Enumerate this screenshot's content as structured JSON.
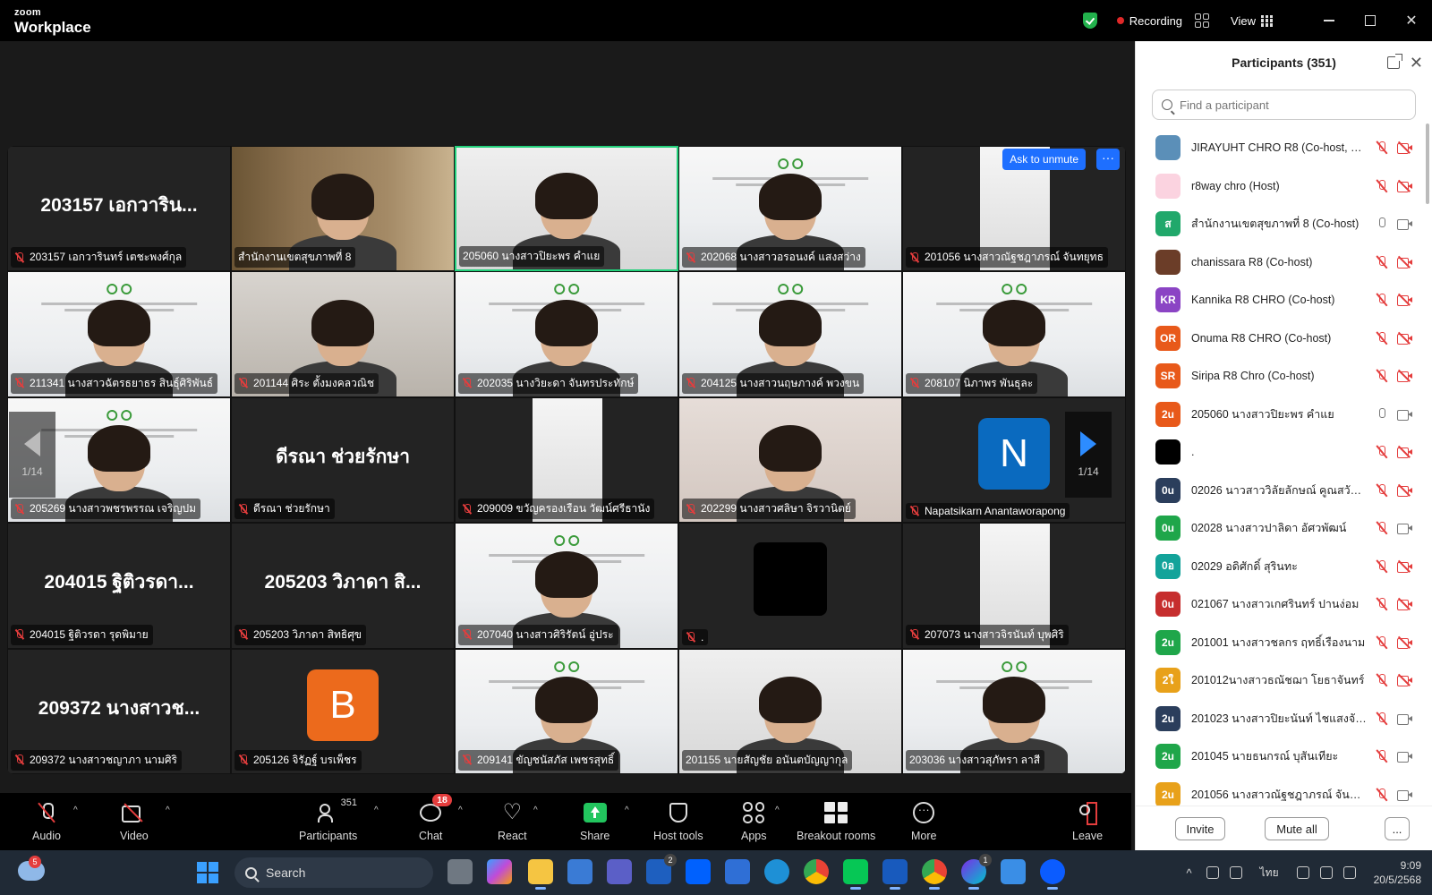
{
  "app": {
    "logo_top": "zoom",
    "logo_bottom": "Workplace"
  },
  "titlebar": {
    "recording": "Recording",
    "view": "View"
  },
  "colors": {
    "accent": "#2d8cff",
    "active_speaker": "#22d07a",
    "muted": "#e43d3d",
    "share": "#22c55e"
  },
  "gallery": {
    "ask_to_unmute": "Ask to unmute",
    "page_left": "1/14",
    "page_right": "1/14",
    "tiles": [
      {
        "big": "203157 เอกวาริน...",
        "name": "203157 เอกวารินทร์ เตชะพงศ์กุล",
        "muted": true,
        "bg": "dark"
      },
      {
        "big": "",
        "name": "สำนักงานเขตสุขภาพที่ 8",
        "muted": false,
        "bg": "office"
      },
      {
        "big": "",
        "name": "205060 นางสาวปิยะพร คำแย",
        "muted": false,
        "bg": "white",
        "active": true
      },
      {
        "big": "",
        "name": "202068 นางสาวอรอนงค์ แสงสว่าง",
        "muted": true,
        "bg": "slide"
      },
      {
        "big": "",
        "name": "201056 นางสาวณัฐชฎาภรณ์ จันทยุทธ",
        "muted": true,
        "bg": "portrait"
      },
      {
        "big": "",
        "name": "211341 นางสาวฉัตรธยาธร สินธุ์ศิริพันธ์",
        "muted": true,
        "bg": "slide"
      },
      {
        "big": "",
        "name": "201144 ศิระ ตั้งมงคลวณิช",
        "muted": true,
        "bg": "room"
      },
      {
        "big": "",
        "name": "202035 นางวิยะดา จันทรประทักษ์",
        "muted": true,
        "bg": "slide"
      },
      {
        "big": "",
        "name": "204125 นางสาวนฤษภางค์ พวงขน",
        "muted": true,
        "bg": "slide"
      },
      {
        "big": "",
        "name": "208107 นิภาพร พันธุละ",
        "muted": true,
        "bg": "slide"
      },
      {
        "big": "",
        "name": "205269 นางสาวพชรพรรณ เจริญปม",
        "muted": true,
        "bg": "slide"
      },
      {
        "big": "ดีรณา ช่วยรักษา",
        "name": "ดีรณา ช่วยรักษา",
        "muted": true,
        "bg": "dark"
      },
      {
        "big": "",
        "name": "209009 ขวัญครองเรือน วัฒน์ศรีธานัง",
        "muted": true,
        "bg": "portrait"
      },
      {
        "big": "",
        "name": "202299 นางสาวศลิษา จิรวานิตย์",
        "muted": true,
        "bg": "bedroom"
      },
      {
        "big": "",
        "name": "Napatsikarn Anantaworapong",
        "muted": true,
        "bg": "avatar",
        "avatar": "N",
        "avatar_color": "#0a6abf"
      },
      {
        "big": "204015 ฐิติวรดา...",
        "name": "204015 ฐิติวรดา รุดพิมาย",
        "muted": true,
        "bg": "dark"
      },
      {
        "big": "205203 วิภาดา สิ...",
        "name": "205203 วิภาดา สิทธิศุข",
        "muted": true,
        "bg": "dark"
      },
      {
        "big": "",
        "name": "207040 นางสาวศิริรัตน์ อู่ประ",
        "muted": true,
        "bg": "slide"
      },
      {
        "big": "",
        "name": ".",
        "muted": true,
        "bg": "blackbox"
      },
      {
        "big": "",
        "name": "207073 นางสาวจิรนันท์ บุพศิริ",
        "muted": true,
        "bg": "portrait"
      },
      {
        "big": "209372 นางสาวช...",
        "name": "209372 นางสาวชญาภา นามศิริ",
        "muted": true,
        "bg": "dark"
      },
      {
        "big": "",
        "name": "205126 จิรัฏฐ์ บรเพ็ชร",
        "muted": true,
        "bg": "avatar",
        "avatar": "B",
        "avatar_color": "#ec6a1c"
      },
      {
        "big": "",
        "name": "209141 ขัญชนัสภัส เพชรสุทธิ์",
        "muted": true,
        "bg": "slide"
      },
      {
        "big": "",
        "name": "201155 นายสัญชัย อนันตบัญญากุล",
        "muted": false,
        "bg": "white"
      },
      {
        "big": "",
        "name": "203036 นางสาวสุภัทรา ลาสี",
        "muted": false,
        "bg": "slide"
      }
    ]
  },
  "panel": {
    "title": "Participants (351)",
    "search_placeholder": "Find a participant",
    "invite": "Invite",
    "mute_all": "Mute all",
    "more": "...",
    "participants": [
      {
        "initials": "",
        "color": "#5b8fb8",
        "name": "JIRAYUHT CHRO R8 (Co-host, me)",
        "mic": "off",
        "cam": "off"
      },
      {
        "initials": "",
        "color": "#fbd3e0",
        "name": "r8way chro (Host)",
        "mic": "off",
        "cam": "off"
      },
      {
        "initials": "ส",
        "color": "#21a86b",
        "name": "สำนักงานเขตสุขภาพที่ 8 (Co-host)",
        "mic": "on",
        "cam": "on"
      },
      {
        "initials": "",
        "color": "#6b3d28",
        "name": "chanissara R8 (Co-host)",
        "mic": "off",
        "cam": "off"
      },
      {
        "initials": "KR",
        "color": "#8b44c4",
        "name": "Kannika R8 CHRO (Co-host)",
        "mic": "off",
        "cam": "off"
      },
      {
        "initials": "OR",
        "color": "#e8591a",
        "name": "Onuma R8 CHRO (Co-host)",
        "mic": "off",
        "cam": "off"
      },
      {
        "initials": "SR",
        "color": "#e8591a",
        "name": "Siripa R8 Chro (Co-host)",
        "mic": "off",
        "cam": "off"
      },
      {
        "initials": "2u",
        "color": "#e8591a",
        "name": "205060 นางสาวปิยะพร คำแย",
        "mic": "on",
        "cam": "on"
      },
      {
        "initials": "",
        "color": "#000000",
        "name": ".",
        "mic": "off",
        "cam": "off"
      },
      {
        "initials": "0u",
        "color": "#2b3e5c",
        "name": "02026 นาวสาววิลัยลักษณ์ คูณสวัสดิ...",
        "mic": "off",
        "cam": "off"
      },
      {
        "initials": "0u",
        "color": "#1fa64a",
        "name": "02028 นางสาวปาลิดา อัศวพัฒน์",
        "mic": "off",
        "cam": "on"
      },
      {
        "initials": "0อ",
        "color": "#13a39a",
        "name": "02029 อดิศักดิ์ สุรินทะ",
        "mic": "off",
        "cam": "off"
      },
      {
        "initials": "0u",
        "color": "#c62e2e",
        "name": "021067 นางสาวเกศรินทร์ ปานง่อม",
        "mic": "off",
        "cam": "off"
      },
      {
        "initials": "2u",
        "color": "#1fa64a",
        "name": "201001 นางสาวชลกร ฤทธิ์เรืองนาม",
        "mic": "off",
        "cam": "off"
      },
      {
        "initials": "2ใ",
        "color": "#e8a11a",
        "name": "201012นางสาวธณัชฌา โยธาจันทร์",
        "mic": "off",
        "cam": "off"
      },
      {
        "initials": "2u",
        "color": "#2b3e5c",
        "name": "201023 นางสาวปิยะนันท์ ไชแสงจันทร์",
        "mic": "off",
        "cam": "on"
      },
      {
        "initials": "2u",
        "color": "#1fa64a",
        "name": "201045 นายธนกรณ์ บุสันเทียะ",
        "mic": "off",
        "cam": "on"
      },
      {
        "initials": "2u",
        "color": "#e8a11a",
        "name": "201056 นางสาวณัฐชฎาภรณ์ จันทยุ...",
        "mic": "off",
        "cam": "on"
      }
    ]
  },
  "toolbar": {
    "audio": "Audio",
    "video": "Video",
    "participants": "Participants",
    "participants_count": "351",
    "chat": "Chat",
    "chat_badge": "18",
    "react": "React",
    "share": "Share",
    "host_tools": "Host tools",
    "apps": "Apps",
    "breakout": "Breakout rooms",
    "more": "More",
    "leave": "Leave"
  },
  "taskbar": {
    "search": "Search",
    "weather_badge": "5",
    "lang": "ไทย",
    "time": "9:09",
    "date": "20/5/2568",
    "teams_badge": "2",
    "zoom_badge": "1"
  }
}
